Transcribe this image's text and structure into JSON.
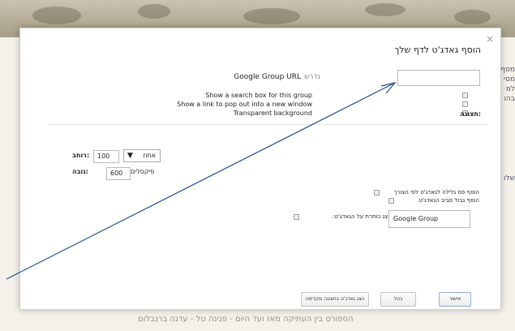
{
  "dialog": {
    "title": "הוסף גאדג'ט לדף שלך",
    "close": "×",
    "url_required": "נדרש",
    "url_label": "Google Group URL",
    "options": [
      "Show a search box for this group",
      "Show a link to pop out into a new window",
      "Transparent background"
    ],
    "display_label": ":תצוגה",
    "width_label": ":רוחב",
    "width_value": "100",
    "width_unit": "אחוז",
    "height_label": ":גובה",
    "height_value": "600",
    "height_unit": "פיקסלים",
    "scroll_option": "הוסף פס גלילה לגאדג'ט לפי הצורך",
    "border_option": "הוסף גבול סביב הגאדג'ט",
    "show_title_label": "הצג כותרת על הגאדג'ט:",
    "title_value": "Google Group",
    "buttons": {
      "preview": "הצג גאדג'ט בתצוגה מקדימה",
      "cancel": "בטל",
      "ok": "אישור"
    }
  },
  "page": {
    "footer": "הספורט בין העתיקה מאז ועד היום  -  פנינה טל - עדנה ברנבלום",
    "side_lines": [
      "מסף",
      "מסי",
      "למ",
      "בהו"
    ],
    "side_left": "שלו"
  },
  "annotation": {
    "arrow_color": "#1f4f8c"
  }
}
